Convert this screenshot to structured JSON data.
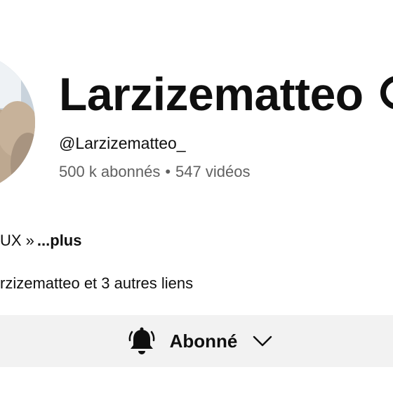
{
  "channel": {
    "name": "Larzizematteo",
    "handle": "@Larzizematteo_",
    "subscribers": "500 k abonnés",
    "separator": "•",
    "videos": "547 vidéos"
  },
  "description": {
    "text": "UX »",
    "more_label": "...plus"
  },
  "links": {
    "text": "rzizematteo et 3 autres liens"
  },
  "subscribe": {
    "label": "Abonné",
    "bell_icon": "bell-icon",
    "chevron_icon": "chevron-down-icon"
  },
  "colors": {
    "primary_text": "#0f0f0f",
    "secondary_text": "#606060",
    "button_bg": "#f2f2f2"
  }
}
